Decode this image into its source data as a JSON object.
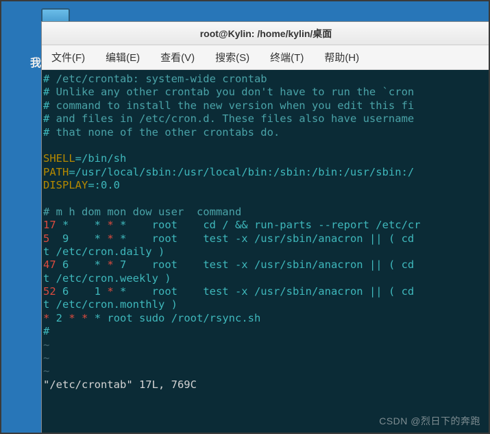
{
  "desktop": {
    "partial_label": "我"
  },
  "window": {
    "title": "root@Kylin: /home/kylin/桌面"
  },
  "menubar": {
    "file": "文件(F)",
    "edit": "编辑(E)",
    "view": "查看(V)",
    "search": "搜索(S)",
    "terminal": "终端(T)",
    "help": "帮助(H)"
  },
  "terminal": {
    "l1": {
      "hash": "#",
      "rest": " /etc/crontab: system-wide crontab"
    },
    "l2": {
      "hash": "#",
      "rest": " Unlike any other crontab you don't have to run the `cron"
    },
    "l3": {
      "hash": "#",
      "rest": " command to install the new version when you edit this fi"
    },
    "l4": {
      "hash": "#",
      "rest": " and files in /etc/cron.d. These files also have username"
    },
    "l5": {
      "hash": "#",
      "rest": " that none of the other crontabs do."
    },
    "blank1": " ",
    "shell_k": "SHELL",
    "shell_v": "=/bin/sh",
    "path_k": "PATH",
    "path_v": "=/usr/local/sbin:/usr/local/bin:/sbin:/bin:/usr/sbin:/",
    "display_k": "DISPLAY",
    "display_v": "=:0.0",
    "blank2": " ",
    "header": "# m h dom mon dow user  command",
    "r1": {
      "a": "17",
      "b": " *    * ",
      "c": "*",
      "d": " *    root    cd / && run-parts --report /etc/cr"
    },
    "r2": {
      "a": "5 ",
      "b": " 9    * ",
      "c": "*",
      "d": " *    root    test -x /usr/sbin/anacron || ( cd "
    },
    "r2b": "t /etc/cron.daily )",
    "r3": {
      "a": "47",
      "b": " 6    * ",
      "c": "*",
      "d": " 7    root    test -x /usr/sbin/anacron || ( cd "
    },
    "r3b": "t /etc/cron.weekly )",
    "r4": {
      "a": "52",
      "b": " 6    1 ",
      "c": "*",
      "d": " *    root    test -x /usr/sbin/anacron || ( cd "
    },
    "r4b": "t /etc/cron.monthly )",
    "r5": {
      "a": "*",
      "b": " 2 ",
      "c": "*",
      "d": " ",
      "e": "*",
      "f": " * root sudo /root/rsync.sh"
    },
    "hash_end": "#",
    "tilde": "~",
    "status": "\"/etc/crontab\" 17L, 769C"
  },
  "watermark": "CSDN @烈日下的奔跑"
}
